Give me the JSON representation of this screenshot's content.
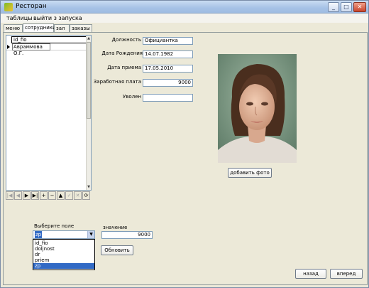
{
  "window": {
    "title": "Ресторан",
    "min": "_",
    "max": "□",
    "close": "✕"
  },
  "menu": [
    {
      "label": "таблицы"
    },
    {
      "label": "выйти з запуска"
    }
  ],
  "tabs": [
    {
      "label": "меню"
    },
    {
      "label": "сотрудники"
    },
    {
      "label": "зал"
    },
    {
      "label": "заказы"
    }
  ],
  "grid": {
    "column": "id_fio",
    "rows": [
      "Авраммова О.Г."
    ]
  },
  "navigator": {
    "buttons": [
      "|◀",
      "◀",
      "▶",
      "▶|",
      "+",
      "−",
      "▲",
      "✓",
      "✕",
      "⟳"
    ]
  },
  "form": {
    "position_label": "Должность",
    "position_value": "Официантка",
    "birth_label": "Дата Рождения",
    "birth_value": "14.07.1982",
    "hire_label": "Дата приема",
    "hire_value": "17.05.2010",
    "salary_label": "Заработная плата",
    "salary_value": "9000",
    "fired_label": "Уволен",
    "fired_value": ""
  },
  "photo": {
    "add_label": "добавить фото"
  },
  "filter": {
    "field_label": "Выберите поле",
    "selected": "zp",
    "options": [
      "id_fio",
      "doljnost",
      "dr",
      "priem",
      "zp"
    ],
    "value_label": "значение",
    "value": "9000",
    "update_label": "Обновить"
  },
  "footer": {
    "back_label": "назад",
    "forward_label": "вперед"
  }
}
